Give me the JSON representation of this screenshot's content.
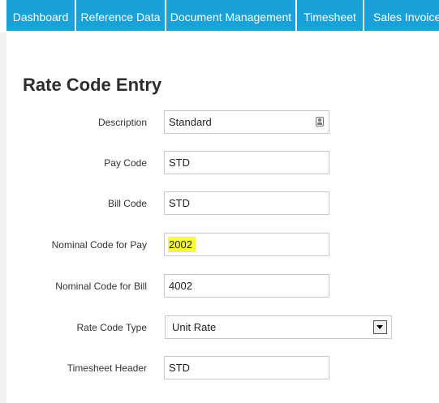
{
  "nav": {
    "tabs": [
      {
        "label": "Dashboard"
      },
      {
        "label": "Reference Data"
      },
      {
        "label": "Document Management"
      },
      {
        "label": "Timesheet"
      },
      {
        "label": "Sales Invoices"
      }
    ]
  },
  "page": {
    "title": "Rate Code Entry"
  },
  "form": {
    "description": {
      "label": "Description",
      "value": "Standard"
    },
    "pay_code": {
      "label": "Pay Code",
      "value": "STD"
    },
    "bill_code": {
      "label": "Bill Code",
      "value": "STD"
    },
    "nominal_pay": {
      "label": "Nominal Code for Pay",
      "value": "2002"
    },
    "nominal_bill": {
      "label": "Nominal Code for Bill",
      "value": "4002"
    },
    "rate_code_type": {
      "label": "Rate Code Type",
      "value": "Unit Rate"
    },
    "timesheet_header": {
      "label": "Timesheet Header",
      "value": "STD"
    }
  },
  "colors": {
    "nav_tab": "#1aa1d8",
    "highlight": "#f7ff3c"
  },
  "icons": {
    "description_field": "contact-card-icon",
    "rate_code_type": "chevron-down-icon"
  }
}
